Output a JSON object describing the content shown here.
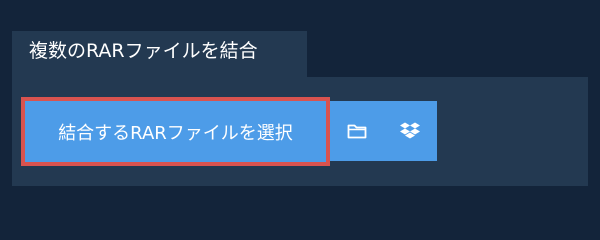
{
  "tab": {
    "title": "複数のRARファイルを結合"
  },
  "upload": {
    "button_label": "結合するRARファイルを選択",
    "folder_icon": "folder-icon",
    "dropbox_icon": "dropbox-icon"
  },
  "colors": {
    "page_background": "#13243a",
    "panel_background": "#233951",
    "button_background": "#4d9ce8",
    "button_highlight_border": "#d9534f",
    "text": "#ffffff"
  }
}
